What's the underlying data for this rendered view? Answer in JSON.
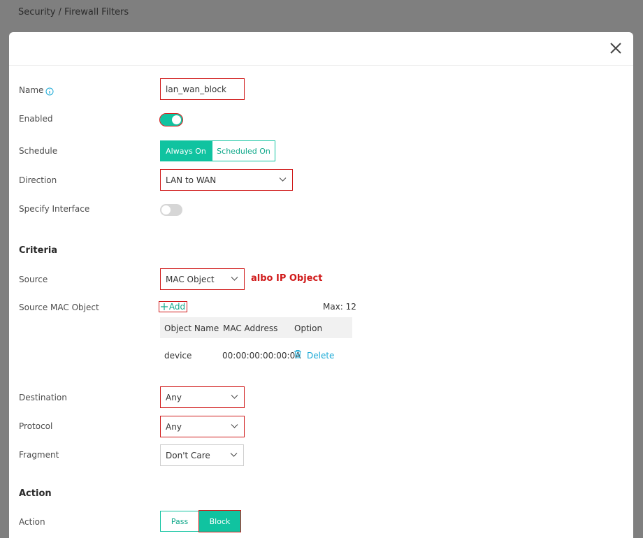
{
  "breadcrumb": "Security / Firewall Filters",
  "form": {
    "name_label": "Name",
    "name_value": "lan_wan_block",
    "enabled_label": "Enabled",
    "enabled": true,
    "schedule_label": "Schedule",
    "schedule_options": [
      "Always On",
      "Scheduled On"
    ],
    "schedule_selected": "Always On",
    "direction_label": "Direction",
    "direction_value": "LAN to WAN",
    "specify_interface_label": "Specify Interface",
    "specify_interface": false
  },
  "criteria": {
    "heading": "Criteria",
    "source_label": "Source",
    "source_value": "MAC Object",
    "note": "albo IP Object",
    "source_mac_label": "Source MAC Object",
    "add_label": "Add",
    "max_label": "Max: 12",
    "table_headers": [
      "Object Name",
      "MAC Address",
      "Option"
    ],
    "rows": [
      {
        "name": "device",
        "mac": "00:00:00:00:00:0A",
        "option": "Delete"
      }
    ],
    "destination_label": "Destination",
    "destination_value": "Any",
    "protocol_label": "Protocol",
    "protocol_value": "Any",
    "fragment_label": "Fragment",
    "fragment_value": "Don't Care"
  },
  "action": {
    "heading": "Action",
    "label": "Action",
    "options": [
      "Pass",
      "Block"
    ],
    "selected": "Block"
  },
  "icons": {
    "info": "info-icon",
    "close": "close-icon",
    "chevron": "chevron-down-icon",
    "trash": "trash-icon",
    "plus": "plus-icon"
  },
  "colors": {
    "accent": "#10c3a0",
    "highlight": "#d01a1a",
    "link": "#1aa9d6"
  }
}
